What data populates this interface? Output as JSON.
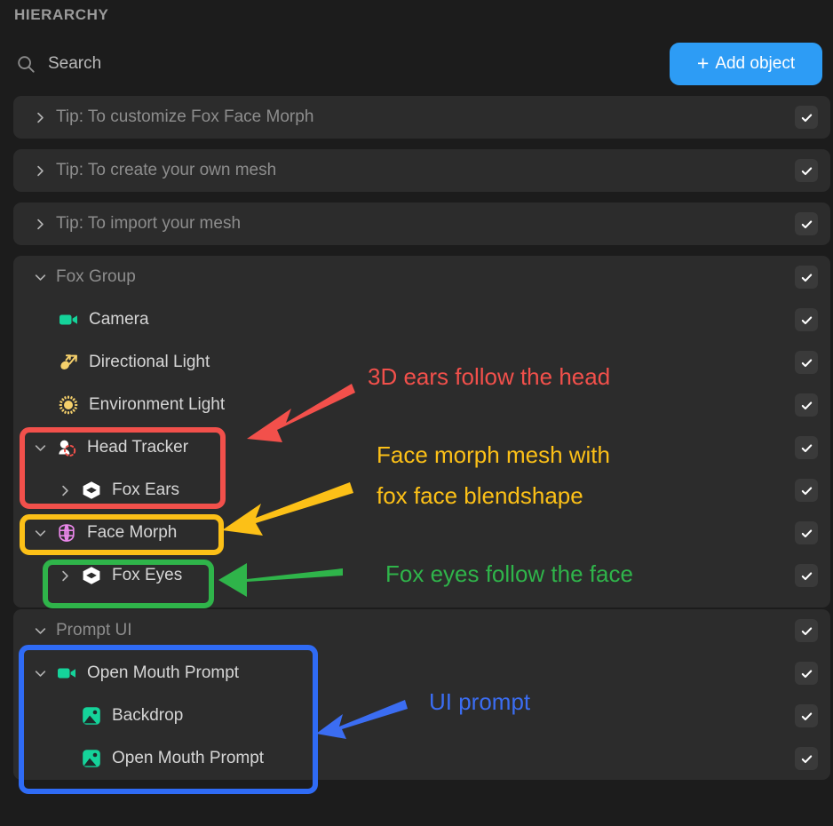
{
  "header": {
    "title": "HIERARCHY",
    "search_placeholder": "Search",
    "search_value": "",
    "search_icon": "search-icon",
    "add_button": {
      "label": "Add object",
      "plus": "+",
      "color": "#2d9cf5"
    }
  },
  "tips": [
    {
      "label": "Tip: To customize Fox Face Morph",
      "chevron": "chevron-right-icon",
      "checked": true
    },
    {
      "label": "Tip: To create your own mesh",
      "chevron": "chevron-right-icon",
      "checked": true
    },
    {
      "label": "Tip: To import your mesh",
      "chevron": "chevron-right-icon",
      "checked": true
    }
  ],
  "fox_group": {
    "label": "Fox Group",
    "chevron": "chevron-down-icon",
    "children": [
      {
        "label": "Camera",
        "icon": "camera-icon",
        "icon_color": "#15d39a",
        "indent": 1,
        "chevron": null,
        "checked": true
      },
      {
        "label": "Directional Light",
        "icon": "directional-light-icon",
        "icon_color": "#f5d06b",
        "indent": 1,
        "chevron": null,
        "checked": true
      },
      {
        "label": "Environment Light",
        "icon": "environment-light-icon",
        "icon_color": "#f5d06b",
        "indent": 1,
        "chevron": null,
        "checked": true
      },
      {
        "label": "Head Tracker",
        "icon": "head-tracker-icon",
        "icon_color": "#ffffff",
        "indent": 0,
        "chevron": "chevron-down-icon",
        "checked": true
      },
      {
        "label": "Fox Ears",
        "icon": "mesh-cube-icon",
        "icon_color": "#ffffff",
        "indent": 1,
        "chevron": "chevron-right-icon",
        "checked": true
      },
      {
        "label": "Face Morph",
        "icon": "face-morph-icon",
        "icon_color": "#e887e8",
        "indent": 0,
        "chevron": "chevron-down-icon",
        "checked": true
      },
      {
        "label": "Fox Eyes",
        "icon": "mesh-cube-icon",
        "icon_color": "#ffffff",
        "indent": 1,
        "chevron": "chevron-right-icon",
        "checked": true
      }
    ]
  },
  "prompt_ui": {
    "label": "Prompt UI",
    "chevron": "chevron-down-icon",
    "children": [
      {
        "label": "Open Mouth Prompt",
        "icon": "camera-icon",
        "icon_color": "#15d39a",
        "indent": 0,
        "chevron": "chevron-down-icon",
        "checked": true
      },
      {
        "label": "Backdrop",
        "icon": "image-icon",
        "icon_color": "#15d39a",
        "indent": 1,
        "chevron": null,
        "checked": true
      },
      {
        "label": "Open Mouth Prompt",
        "icon": "image-icon",
        "icon_color": "#15d39a",
        "indent": 1,
        "chevron": null,
        "checked": true
      }
    ]
  },
  "annotations": [
    {
      "id": "red",
      "text": "3D ears follow the head",
      "color": "#f2504b"
    },
    {
      "id": "yellow",
      "line1": "Face morph mesh with",
      "line2": "fox face blendshape",
      "color": "#fcc017"
    },
    {
      "id": "green",
      "text": "Fox eyes follow the face",
      "color": "#2fb44a"
    },
    {
      "id": "blue",
      "text": "UI prompt",
      "color": "#3b6df2"
    }
  ],
  "highlight_boxes": [
    {
      "id": "head-tracker-box",
      "color": "#f2504b",
      "target": "Head Tracker + Fox Ears"
    },
    {
      "id": "face-morph-box",
      "color": "#fcc017",
      "target": "Face Morph"
    },
    {
      "id": "fox-eyes-box",
      "color": "#2fb44a",
      "target": "Fox Eyes"
    },
    {
      "id": "prompt-ui-box",
      "color": "#2f6bf5",
      "target": "Open Mouth Prompt group"
    }
  ]
}
